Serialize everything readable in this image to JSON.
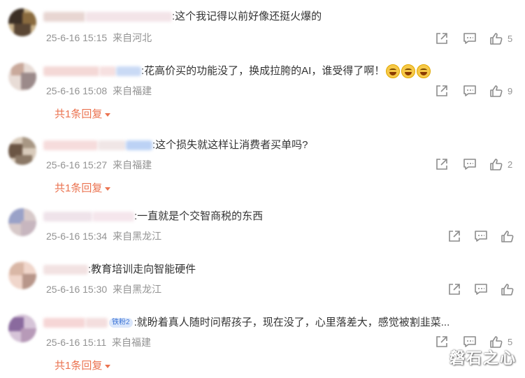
{
  "comments": [
    {
      "text": ":这个我记得以前好像还挺火爆的",
      "date": "25-6-16 15:15",
      "source": "来自河北",
      "likes": "5",
      "reply_label": "",
      "name_colors": [
        "#e8d6d2",
        "#f3e4e8"
      ],
      "avatar_colors": [
        "#3b2f25",
        "#c9b28a",
        "#8a6b3f"
      ]
    },
    {
      "text": ":花高价买的功能没了，换成拉胯的AI，谁受得了啊！",
      "date": "25-6-16 15:08",
      "source": "来自福建",
      "likes": "9",
      "reply_label": "共1条回复",
      "name_colors": [
        "#f4d8d6",
        "#f6e0e0",
        "#c9daf5"
      ],
      "avatar_colors": [
        "#c9a99b",
        "#e8dcd6",
        "#9b8a8a"
      ]
    },
    {
      "text": ":这个损失就这样让消费者买单吗?",
      "date": "25-6-16 15:27",
      "source": "来自福建",
      "likes": "2",
      "reply_label": "共1条回复",
      "name_colors": [
        "#f6dcdc",
        "#f0e6e6",
        "#bcd2f5"
      ],
      "avatar_colors": [
        "#6b5544",
        "#d9cbbb",
        "#a89784"
      ]
    },
    {
      "text": ":一直就是个交智商税的东西",
      "date": "25-6-16 15:34",
      "source": "来自黑龙江",
      "likes": "",
      "reply_label": "",
      "name_colors": [
        "#efe3ea",
        "#f5e6ec"
      ],
      "avatar_colors": [
        "#9aa2c8",
        "#d7c9c9",
        "#c7b6bf"
      ]
    },
    {
      "text": ":教育培训走向智能硬件",
      "date": "25-6-16 15:30",
      "source": "来自黑龙江",
      "likes": "",
      "reply_label": "",
      "name_colors": [
        "#f2e2e2"
      ],
      "avatar_colors": [
        "#d9b7a6",
        "#f0d6cb",
        "#b8968a"
      ]
    },
    {
      "text": ":就盼着真人随时问帮孩子，现在没了，心里落差大，感觉被割韭菜...",
      "date": "25-6-16 15:11",
      "source": "来自福建",
      "likes": "5",
      "reply_label": "共1条回复",
      "badge": "铁粉2",
      "name_colors": [
        "#f6d6d6",
        "#f4dede"
      ],
      "avatar_colors": [
        "#8a6a9e",
        "#d6c4d8",
        "#b79ab8"
      ]
    }
  ],
  "watermark": "磐石之心",
  "colors": {
    "meta": "#939393",
    "reply": "#eb7350",
    "text": "#333333"
  }
}
